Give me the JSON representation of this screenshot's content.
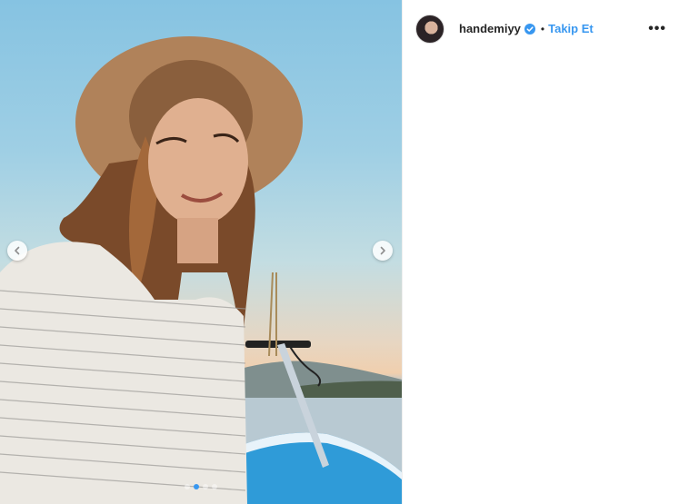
{
  "post": {
    "username": "handemiyy",
    "separator": "•",
    "follow_label": "Takip Et",
    "more_label": "•••",
    "verified": true,
    "carousel": {
      "slide_count": 4,
      "active_index": 1
    }
  },
  "icons": {
    "prev": "chevron-left-icon",
    "next": "chevron-right-icon",
    "verified": "verified-badge-icon",
    "more": "more-options-icon"
  },
  "colors": {
    "accent": "#3897f0",
    "text": "#262626",
    "boat": "#2f9bd8"
  }
}
